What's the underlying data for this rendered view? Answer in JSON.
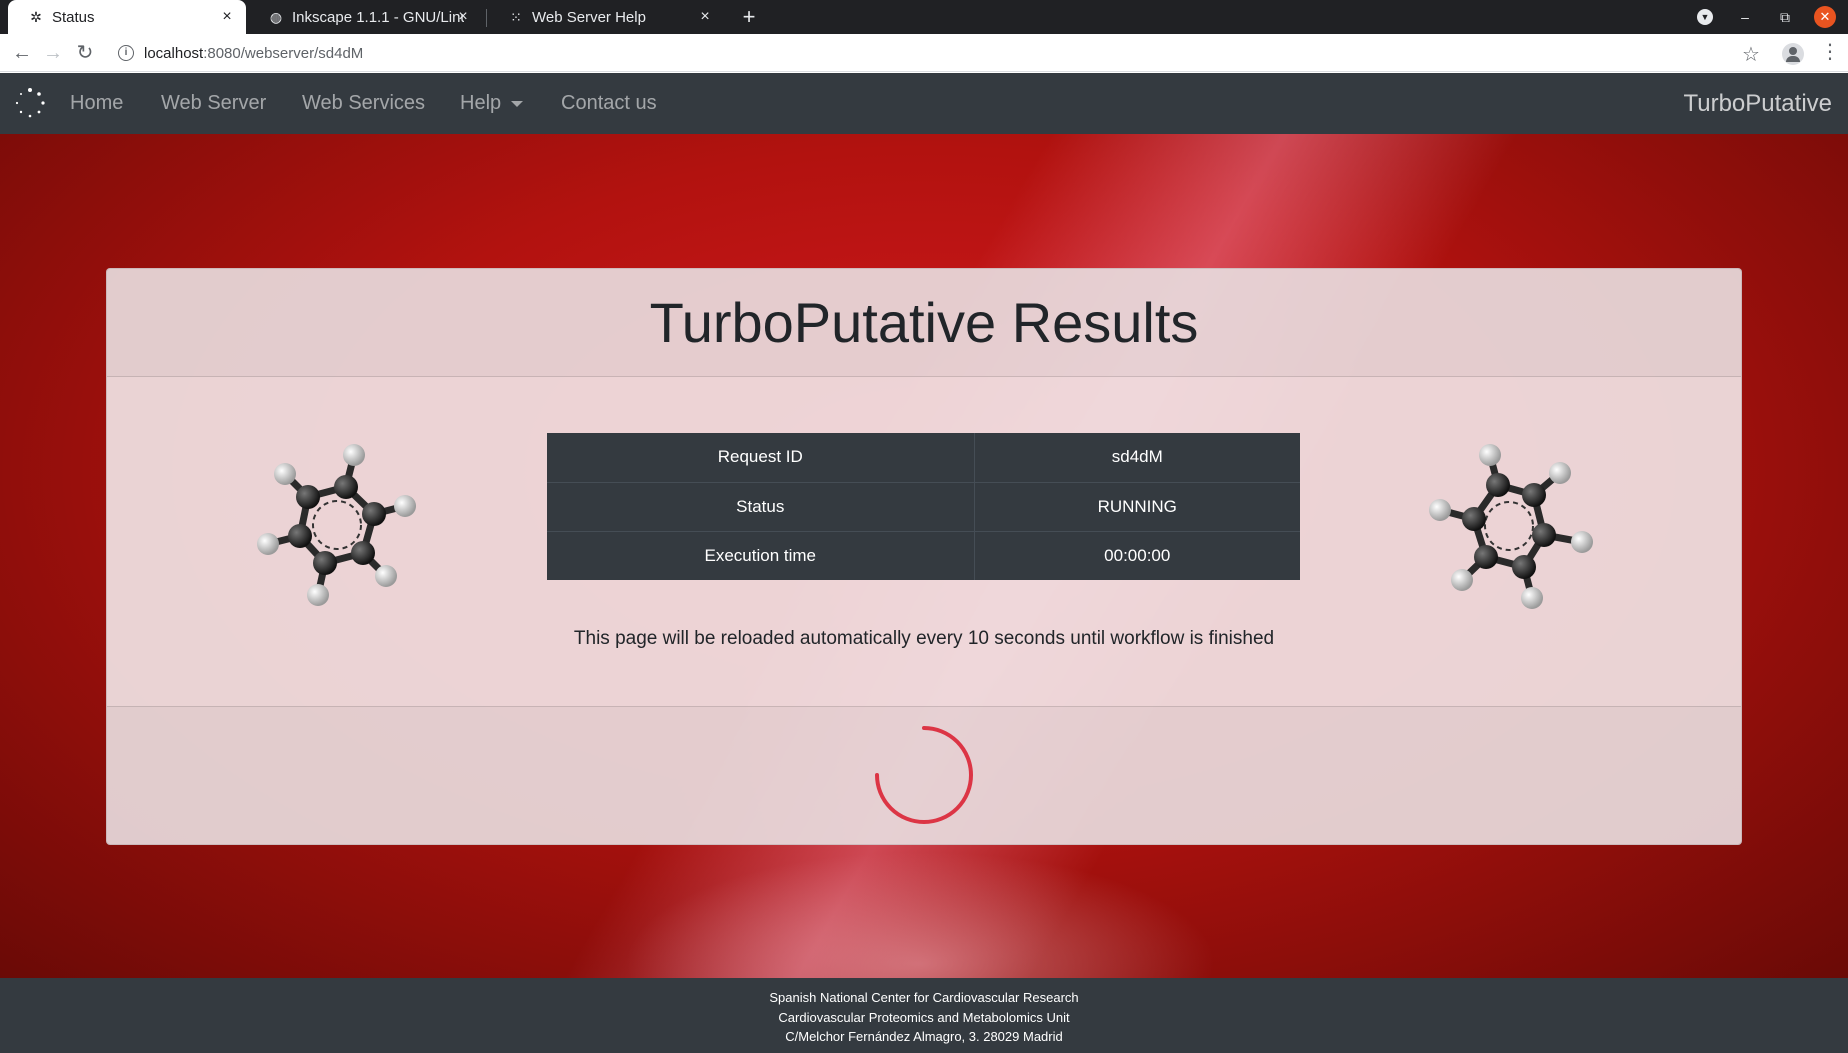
{
  "browser": {
    "tabs": [
      {
        "title": "Status",
        "icon": "turboputative-favicon",
        "active": true
      },
      {
        "title": "Inkscape 1.1.1 - GNU/Linu",
        "icon": "github-icon",
        "active": false
      },
      {
        "title": "Web Server Help",
        "icon": "turboputative-favicon",
        "active": false
      }
    ],
    "url_host": "localhost",
    "url_rest": ":8080/webserver/sd4dM"
  },
  "nav": {
    "links": [
      "Home",
      "Web Server",
      "Web Services",
      "Help",
      "Contact us"
    ],
    "brand": "TurboPutative"
  },
  "card": {
    "title": "TurboPutative Results",
    "rows": [
      {
        "key": "Request ID",
        "value": "sd4dM"
      },
      {
        "key": "Status",
        "value": "RUNNING"
      },
      {
        "key": "Execution time",
        "value": "00:00:00"
      }
    ],
    "note": "This page will be reloaded automatically every 10 seconds until workflow is finished"
  },
  "footer": {
    "lines": [
      "Spanish National Center for Cardiovascular Research",
      "Cardiovascular Proteomics and Metabolomics Unit",
      "C/Melchor Fernández Almagro, 3. 28029 Madrid"
    ]
  },
  "colors": {
    "navbar": "#343a40",
    "spinner": "#dc3545",
    "hero": "#c8151a"
  }
}
